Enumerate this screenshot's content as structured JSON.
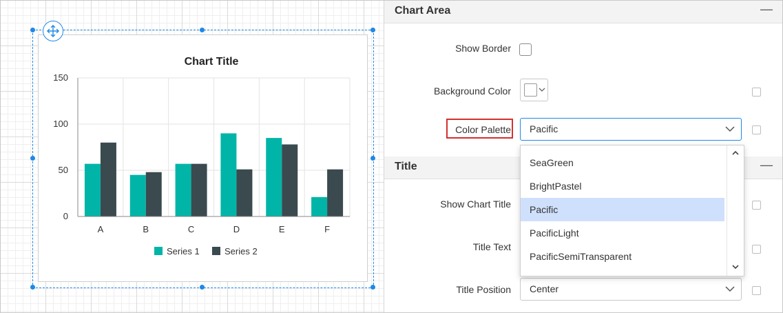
{
  "chart_data": {
    "type": "bar",
    "title": "Chart Title",
    "categories": [
      "A",
      "B",
      "C",
      "D",
      "E",
      "F"
    ],
    "series": [
      {
        "name": "Series 1",
        "values": [
          57,
          45,
          57,
          90,
          85,
          21
        ],
        "color": "#00b5a8"
      },
      {
        "name": "Series 2",
        "values": [
          80,
          48,
          57,
          51,
          78,
          51
        ],
        "color": "#3a4a4f"
      }
    ],
    "ylim": [
      0,
      150
    ],
    "yticks": [
      "0",
      "50",
      "100",
      "150"
    ],
    "grid": true,
    "legend_position": "bottom"
  },
  "panel": {
    "chart_area": {
      "title": "Chart Area",
      "collapse_glyph": "—",
      "show_border_label": "Show Border",
      "background_color_label": "Background Color",
      "color_palette_label": "Color Palette",
      "color_palette_value": "Pacific",
      "palette_options": [
        "SeaGreen",
        "BrightPastel",
        "Pacific",
        "PacificLight",
        "PacificSemiTransparent"
      ],
      "selected_option": "Pacific",
      "highlight_color": "#d32f2f"
    },
    "title_section": {
      "title": "Title",
      "collapse_glyph": "—",
      "show_chart_title_label": "Show Chart Title",
      "title_text_label": "Title Text",
      "title_position_label": "Title Position",
      "title_position_value": "Center"
    }
  },
  "accent_color": "#1e88e5"
}
